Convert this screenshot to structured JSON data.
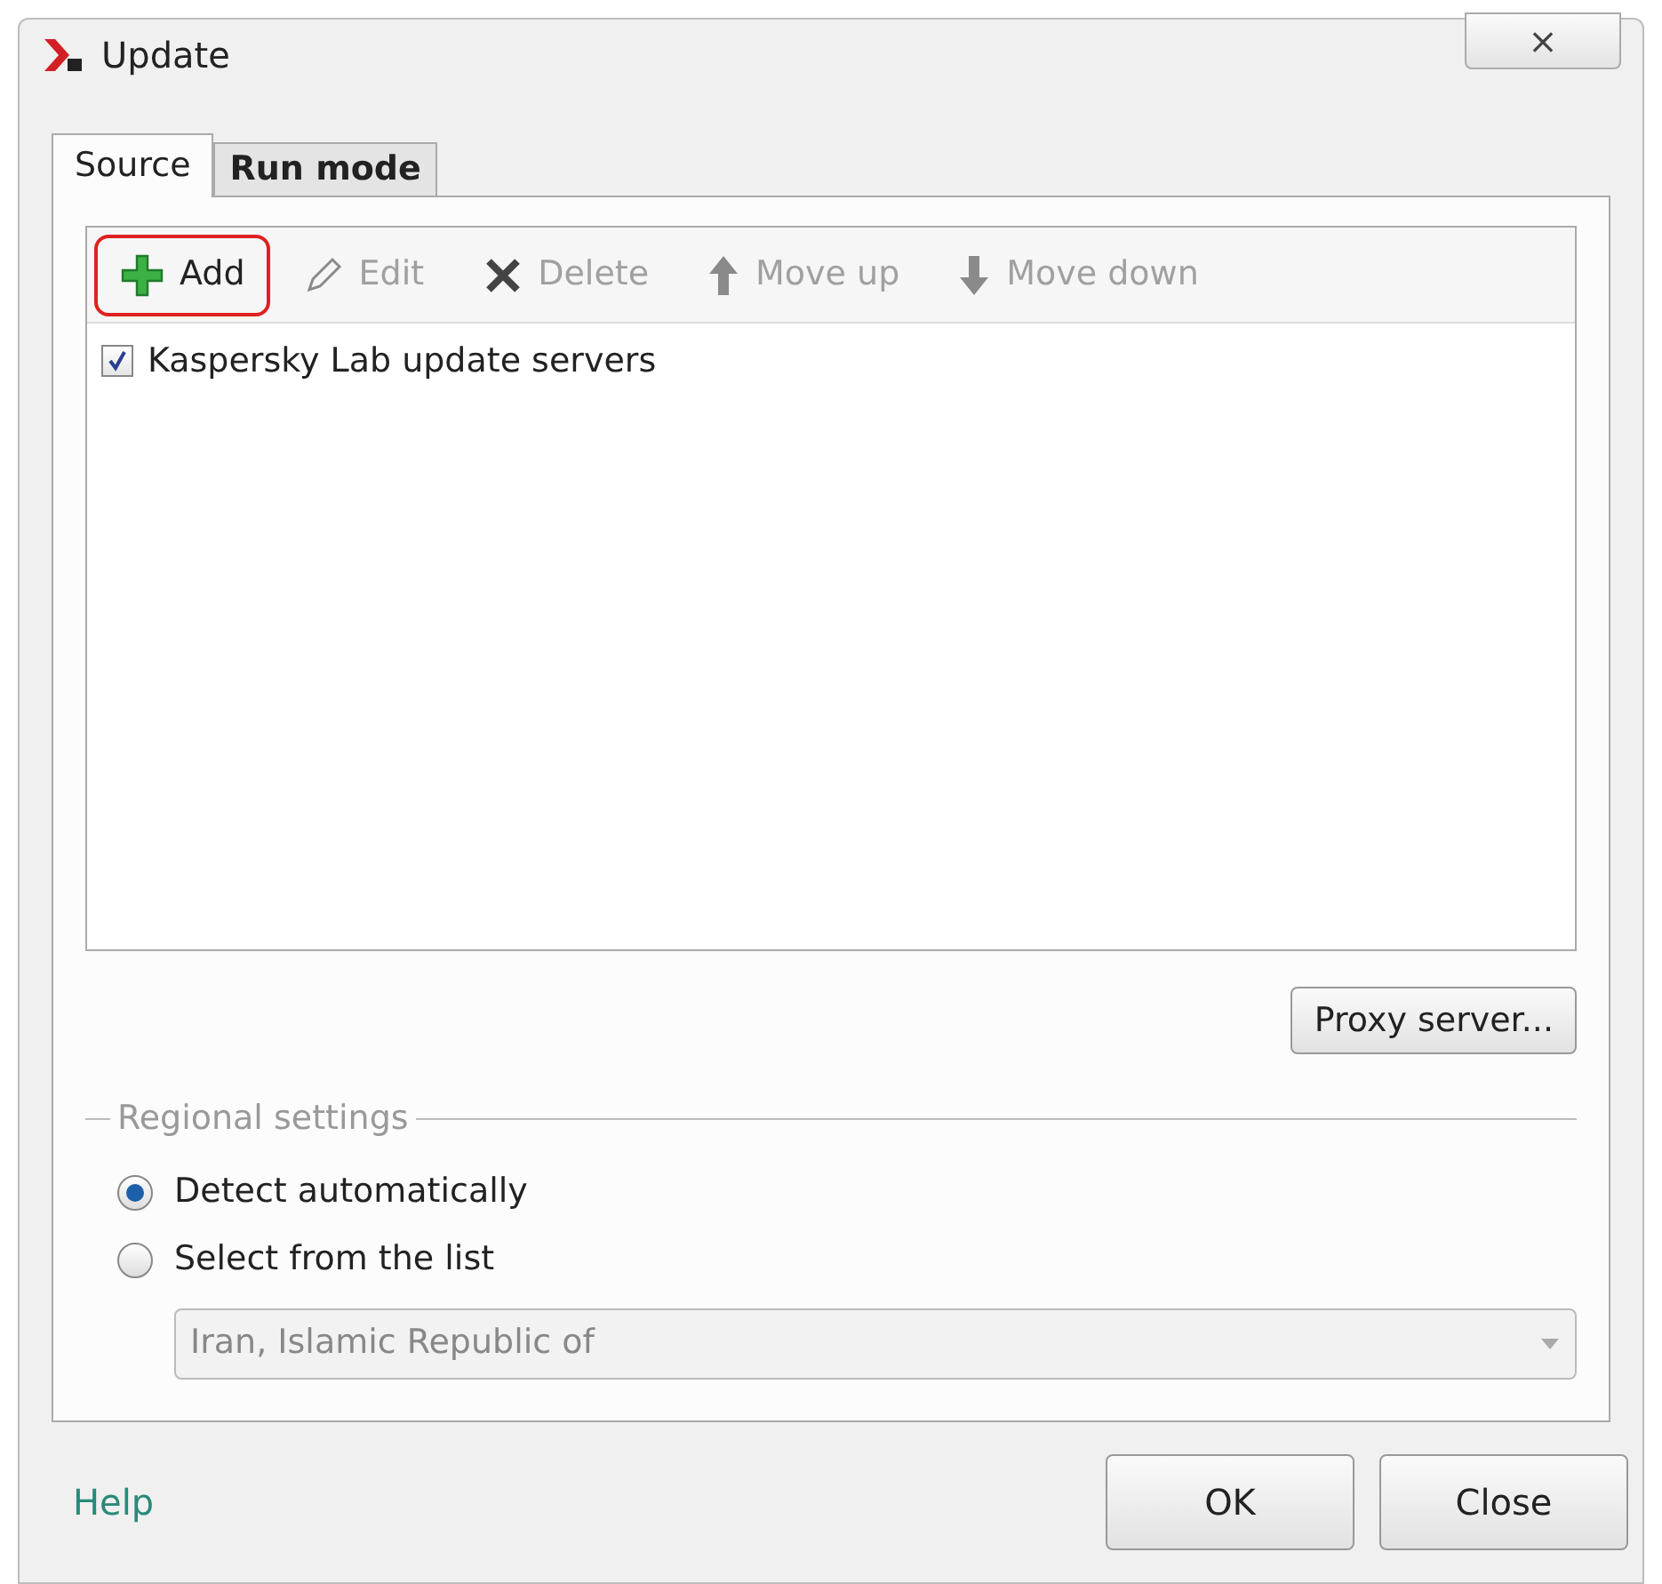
{
  "window": {
    "title": "Update",
    "close": "×"
  },
  "tabs": [
    {
      "label": "Source",
      "selected": true
    },
    {
      "label": "Run mode",
      "selected": false
    }
  ],
  "toolbar": [
    {
      "kind": "add",
      "label": "Add",
      "disabled": false,
      "highlighted": true
    },
    {
      "kind": "edit",
      "label": "Edit",
      "disabled": true,
      "highlighted": false
    },
    {
      "kind": "delete",
      "label": "Delete",
      "disabled": true,
      "highlighted": false
    },
    {
      "kind": "up",
      "label": "Move up",
      "disabled": true,
      "highlighted": false
    },
    {
      "kind": "down",
      "label": "Move down",
      "disabled": true,
      "highlighted": false
    }
  ],
  "sources": [
    {
      "label": "Kaspersky Lab update servers",
      "checked": true
    }
  ],
  "proxy_button": "Proxy server...",
  "regional": {
    "title": "Regional settings",
    "options": [
      {
        "label": "Detect automatically",
        "selected": true
      },
      {
        "label": "Select from the list",
        "selected": false
      }
    ],
    "region": {
      "value": "Iran, Islamic Republic of",
      "disabled": true
    }
  },
  "footer": {
    "help": "Help",
    "buttons": [
      "OK",
      "Close"
    ]
  }
}
